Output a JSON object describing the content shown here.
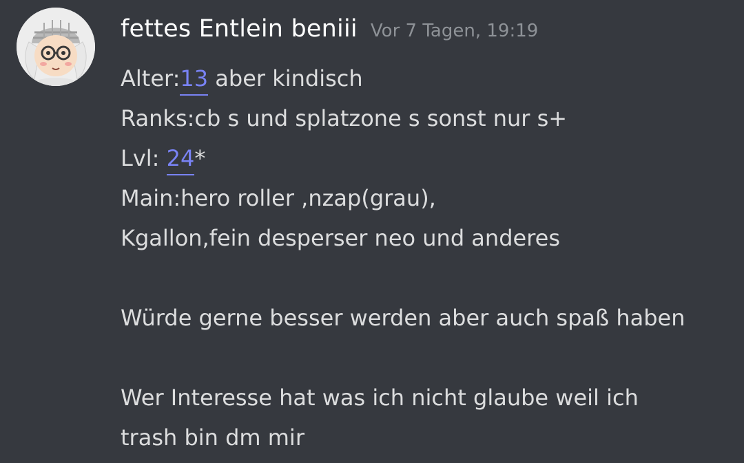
{
  "message": {
    "author": "fettes Entlein beniii",
    "timestamp": "Vor 7 Tagen, 19:19",
    "avatar_icon": "squid-kid-avatar-icon",
    "lines": {
      "l1_prefix": "Alter:",
      "l1_link": "13",
      "l1_suffix": " aber kindisch",
      "l2": "Ranks:cb s und splatzone s sonst nur s+",
      "l3_prefix": "Lvl: ",
      "l3_link": "24",
      "l3_suffix": "*",
      "l4": "Main:hero roller  ,nzap(grau),",
      "l5": "Kgallon,fein desperser neo und anderes",
      "l6": "Würde gerne besser werden aber auch spaß haben",
      "l7": "Wer Interesse hat was ich nicht glaube weil ich",
      "l8": "trash bin dm mir"
    }
  },
  "colors": {
    "background": "#36393f",
    "author": "#ffffff",
    "timestamp": "#8e9297",
    "text": "#dcddde",
    "link": "#7983f5"
  }
}
